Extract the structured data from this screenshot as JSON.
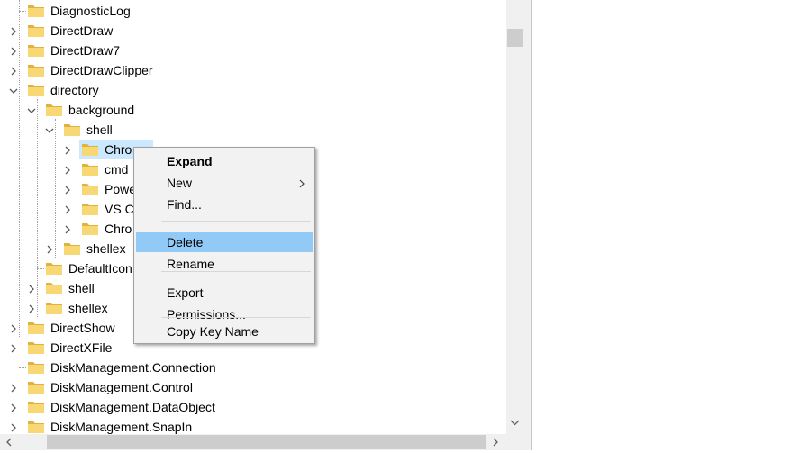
{
  "tree": {
    "items": [
      {
        "label": "DiagnosticLog",
        "expander": "none"
      },
      {
        "label": "DirectDraw",
        "expander": "collapsed"
      },
      {
        "label": "DirectDraw7",
        "expander": "collapsed"
      },
      {
        "label": "DirectDrawClipper",
        "expander": "collapsed"
      },
      {
        "label": "directory",
        "expander": "expanded"
      },
      {
        "label": "background",
        "expander": "expanded"
      },
      {
        "label": "shell",
        "expander": "expanded"
      },
      {
        "label": "Chro",
        "expander": "collapsed",
        "selected": true
      },
      {
        "label": "cmd",
        "expander": "collapsed"
      },
      {
        "label": "Powe",
        "expander": "collapsed"
      },
      {
        "label": "VS Co",
        "expander": "collapsed"
      },
      {
        "label": "Chro",
        "expander": "collapsed"
      },
      {
        "label": "shellex",
        "expander": "collapsed"
      },
      {
        "label": "DefaultIcon",
        "expander": "none"
      },
      {
        "label": "shell",
        "expander": "collapsed"
      },
      {
        "label": "shellex",
        "expander": "collapsed"
      },
      {
        "label": "DirectShow",
        "expander": "collapsed"
      },
      {
        "label": "DirectXFile",
        "expander": "collapsed"
      },
      {
        "label": "DiskManagement.Connection",
        "expander": "none"
      },
      {
        "label": "DiskManagement.Control",
        "expander": "collapsed"
      },
      {
        "label": "DiskManagement.DataObject",
        "expander": "collapsed"
      },
      {
        "label": "DiskManagement.SnapIn",
        "expander": "collapsed"
      }
    ]
  },
  "context_menu": {
    "items": [
      {
        "label": "Expand",
        "bold": true
      },
      {
        "label": "New",
        "submenu": true
      },
      {
        "label": "Find..."
      },
      {
        "separator": true
      },
      {
        "label": "Delete",
        "highlighted": true
      },
      {
        "label": "Rename"
      },
      {
        "separator": true
      },
      {
        "label": "Export"
      },
      {
        "label": "Permissions..."
      },
      {
        "separator": true
      },
      {
        "label": "Copy Key Name"
      }
    ]
  },
  "colors": {
    "folder": "#f8d775",
    "folder_dark": "#e0b23e",
    "selection": "#cce8ff",
    "menu_highlight": "#91c9f7"
  }
}
